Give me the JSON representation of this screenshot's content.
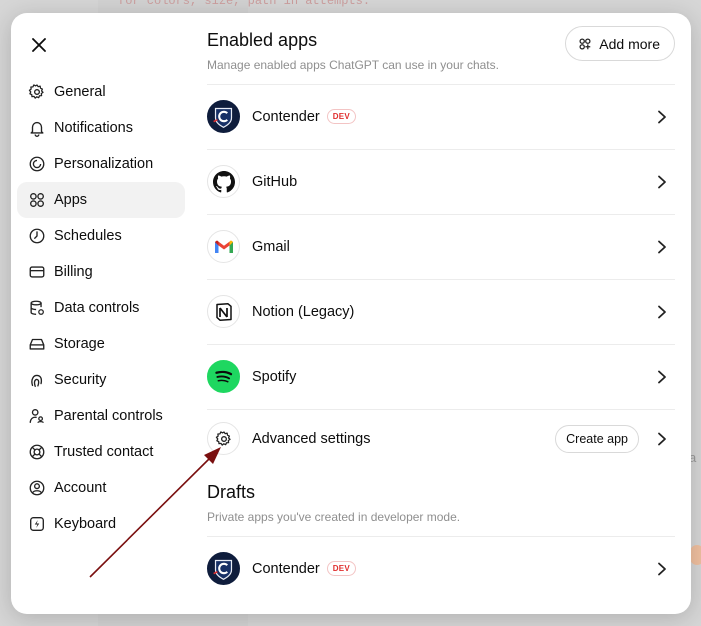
{
  "background": {
    "code_snippet": "for colors, size, path in attempts:"
  },
  "sidebar": {
    "items": [
      {
        "label": "General",
        "icon": "gear-icon"
      },
      {
        "label": "Notifications",
        "icon": "bell-icon"
      },
      {
        "label": "Personalization",
        "icon": "personalization-icon"
      },
      {
        "label": "Apps",
        "icon": "apps-grid-icon",
        "active": true
      },
      {
        "label": "Schedules",
        "icon": "clock-icon"
      },
      {
        "label": "Billing",
        "icon": "credit-card-icon"
      },
      {
        "label": "Data controls",
        "icon": "database-icon"
      },
      {
        "label": "Storage",
        "icon": "storage-icon"
      },
      {
        "label": "Security",
        "icon": "fingerprint-icon"
      },
      {
        "label": "Parental controls",
        "icon": "parental-icon"
      },
      {
        "label": "Trusted contact",
        "icon": "lifebuoy-icon"
      },
      {
        "label": "Account",
        "icon": "user-circle-icon"
      },
      {
        "label": "Keyboard",
        "icon": "keyboard-bolt-icon"
      }
    ]
  },
  "enabled": {
    "title": "Enabled apps",
    "subtitle": "Manage enabled apps ChatGPT can use in your chats.",
    "add_more": "Add more",
    "apps": [
      {
        "name": "Contender",
        "badge": "DEV",
        "icon": "contender-icon"
      },
      {
        "name": "GitHub",
        "icon": "github-icon"
      },
      {
        "name": "Gmail",
        "icon": "gmail-icon"
      },
      {
        "name": "Notion (Legacy)",
        "icon": "notion-icon"
      },
      {
        "name": "Spotify",
        "icon": "spotify-icon"
      }
    ],
    "advanced": {
      "name": "Advanced settings",
      "button": "Create app"
    }
  },
  "drafts": {
    "title": "Drafts",
    "subtitle": "Private apps you've created in developer mode.",
    "apps": [
      {
        "name": "Contender",
        "badge": "DEV",
        "icon": "contender-icon"
      }
    ]
  },
  "colors": {
    "annotation_arrow": "#7a0f0f",
    "dev_badge": "#e02e2e",
    "spotify": "#1ed760"
  }
}
